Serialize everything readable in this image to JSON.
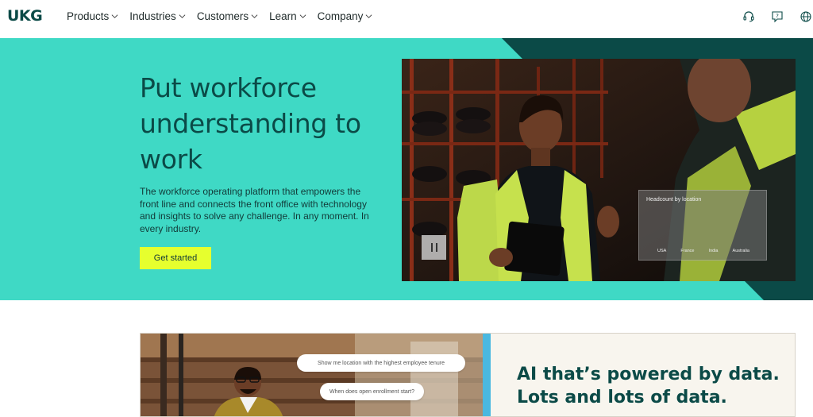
{
  "brand": {
    "logo_text": "UKG"
  },
  "nav": {
    "items": [
      {
        "label": "Products"
      },
      {
        "label": "Industries"
      },
      {
        "label": "Customers"
      },
      {
        "label": "Learn"
      },
      {
        "label": "Company"
      }
    ],
    "icons": [
      "support-headset-icon",
      "help-chat-icon",
      "globe-icon"
    ]
  },
  "hero": {
    "title": "Put workforce understanding to work",
    "subtitle": "The workforce operating platform that empowers the front line and connects the front office with technology and insights to solve any challenge. In any moment. In every industry.",
    "cta_label": "Get started",
    "card": {
      "title": "Headcount by location",
      "labels": [
        "USA",
        "France",
        "India",
        "Australia"
      ]
    }
  },
  "section2": {
    "title": "AI that’s powered by data. Lots and lots of data.",
    "bubbles": [
      "Show me location with the highest employee tenure",
      "When does open enrollment start?"
    ]
  },
  "colors": {
    "hero_bg": "#3fd9c5",
    "brand_dark": "#0b4a47",
    "cta_bg": "#e6ff2e",
    "accent_blue": "#4ab8e0"
  }
}
